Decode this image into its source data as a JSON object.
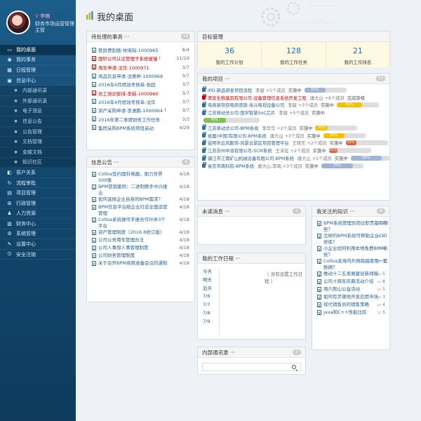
{
  "user": {
    "name": "李楠",
    "role": "财务市场运营管理主管"
  },
  "menu": [
    {
      "label": "我的桌面",
      "icon": "desktop-icon",
      "active": true
    },
    {
      "label": "我的事务",
      "icon": "tasks-icon"
    },
    {
      "label": "日程管理",
      "icon": "calendar-icon"
    },
    {
      "label": "信息中心",
      "icon": "info-icon"
    },
    {
      "label": "内部通讯录",
      "icon": "dot-icon",
      "sub": true
    },
    {
      "label": "外部通讯录",
      "icon": "dot-icon",
      "sub": true
    },
    {
      "label": "电子消息",
      "icon": "dot-icon",
      "sub": true
    },
    {
      "label": "信息公告",
      "icon": "dot-icon",
      "sub": true
    },
    {
      "label": "公告管理",
      "icon": "dot-icon",
      "sub": true
    },
    {
      "label": "文档管理",
      "icon": "dot-icon",
      "sub": true
    },
    {
      "label": "金蝶文档",
      "icon": "dot-icon",
      "sub": true
    },
    {
      "label": "知识社区",
      "icon": "dot-icon",
      "sub": true
    },
    {
      "label": "客户关系",
      "icon": "crm-icon"
    },
    {
      "label": "流程审批",
      "icon": "workflow-icon"
    },
    {
      "label": "项目管理",
      "icon": "project-icon"
    },
    {
      "label": "行政管理",
      "icon": "admin-icon"
    },
    {
      "label": "人力资源",
      "icon": "hr-icon"
    },
    {
      "label": "财务中心",
      "icon": "finance-icon"
    },
    {
      "label": "系统管理",
      "icon": "system-icon"
    },
    {
      "label": "设置中心",
      "icon": "settings-icon"
    },
    {
      "label": "安全注销",
      "icon": "logout-icon"
    }
  ],
  "page_title": "我的桌面",
  "todo": {
    "title": "待处理的事务 ···",
    "count": "18",
    "items": [
      {
        "text": "管龄费刮画-休境瑶-1000965",
        "date": "8/4",
        "red": false
      },
      {
        "text": "国轩公司认证管理子系统缓慢",
        "date": "11/19",
        "red": true,
        "excl": true
      },
      {
        "text": "周年申请-沈华-1000971",
        "date": "3/7",
        "red": true
      },
      {
        "text": "商品信息申请-沈寒婷-1000968",
        "date": "3/7",
        "red": false
      },
      {
        "text": "2016年4月绩效考核单-张超",
        "date": "3/7",
        "red": false
      },
      {
        "text": "员工培训安排-李娟-1000960",
        "date": "3/7",
        "red": true
      },
      {
        "text": "2016年4月绩效考核单-沈华",
        "date": "3/7",
        "red": false
      },
      {
        "text": "资产采购申请-李潇鹏-1000964",
        "date": "3/7",
        "red": false,
        "excl": true
      },
      {
        "text": "2016年第二季度财务工作任务",
        "date": "3/3",
        "red": false
      },
      {
        "text": "集团采购BPM系统项目启动",
        "date": "4/29",
        "red": false
      }
    ]
  },
  "notice": {
    "title": "信息公告 ···",
    "count": "8",
    "items": [
      {
        "text": "Colloa签约国科电器，助力世界500强",
        "date": "4/18"
      },
      {
        "text": "BPM营销案例：二进制携手中兴维业",
        "date": "4/18"
      },
      {
        "text": "如何选择企业自身的BPM需求？",
        "date": "4/18"
      },
      {
        "text": "BPM信息平台助企业打造全面运营管理",
        "date": "4/18"
      },
      {
        "text": "Colloa系统操作手册合作伙伴3个平台",
        "date": "4/18"
      },
      {
        "text": "资产管理制度（2016.8修订版）",
        "date": "4/18"
      },
      {
        "text": "公司公务用车管理办法",
        "date": "4/18"
      },
      {
        "text": "公司人事部人事管理制度",
        "date": "4/18"
      },
      {
        "text": "公司财务管理制度",
        "date": "4/18"
      },
      {
        "text": "关于召开BPM商用准备会议的通知",
        "date": "4/18"
      }
    ]
  },
  "goals": {
    "title": "目标管理",
    "cells": [
      {
        "num": "36",
        "label": "我的工作计划"
      },
      {
        "num": "128",
        "label": "我的工作任务"
      },
      {
        "num": "21",
        "label": "我的工作排名"
      }
    ]
  },
  "projects": {
    "title": "我的项目 ···",
    "count": "13",
    "items": [
      {
        "name": "IPD-新品研发项目流程",
        "meta": "李骏 +5个成员",
        "status": "实施中",
        "pct": 50,
        "color": "#9fb3d6",
        "red": false
      },
      {
        "name": "南安生物基因有限公司-设备管理信息系统开发工程",
        "meta": "唐大山 +6个成员",
        "status": "完成审核",
        "pct": null,
        "red": true
      },
      {
        "name": "电商新项目电商营销-永兴电视设备公司",
        "meta": "李骏 +5个成员",
        "status": "实施中",
        "pct": 60,
        "color": "#f2c200",
        "red": false
      },
      {
        "name": "江苏移动总公司-国学智慧SoC芯片",
        "meta": "李骏 +5个成员",
        "status": "实施中",
        "pct": 40,
        "color": "#7cc456",
        "red": false
      },
      {
        "name": "江苏移动总公司-BPM系统",
        "meta": "李华华 +2个成员",
        "status": "实施中",
        "pct": 30,
        "color": "#f2c200",
        "red": false
      },
      {
        "name": "省属(中国)有限公司-BPM系统",
        "meta": "唐大山 +3个成员",
        "status": "实施中",
        "pct": 50,
        "color": "#f2c200",
        "red": false
      },
      {
        "name": "昆明市云风服饰-风景云景区项目管理平台",
        "meta": "王晓东 +2个成员",
        "status": "实施中",
        "pct": 25,
        "color": "#e0603a",
        "red": false
      },
      {
        "name": "江苏苏州中咨有限公司-SCM系统",
        "meta": "王泽宏 +2个成员",
        "status": "实施中",
        "pct": 20,
        "color": "#e0603a",
        "red": false
      },
      {
        "name": "镇江市江南矿山机械设备有限公司-BPM系统",
        "meta": "唐大山 +1个成员",
        "status": "实施中",
        "pct": 80,
        "color": "#9fb3d6",
        "red": false
      },
      {
        "name": "省农市南科院-BPM系统",
        "meta": "唐大山,李晓,+3个成员",
        "status": "实施中",
        "pct": 75,
        "color": "#9fb3d6",
        "red": false
      }
    ]
  },
  "messages": {
    "title": "未读消息 ···",
    "count": "0"
  },
  "schedule": {
    "title": "我的工作日程 ···",
    "hint": "（ 没有设置工作日程 ）",
    "days": [
      "今天",
      "明天",
      "后天",
      "7/6",
      "7/7",
      "7/8",
      "7/9"
    ]
  },
  "knowledge": {
    "title": "我关注的知识 ···",
    "count": "8",
    "items": [
      {
        "text": "BPM系统管理员岗位职责都有哪些？",
        "num": "6"
      },
      {
        "text": "怎样的BPM系统可帮助企业CIO修炼？",
        "num": "7"
      },
      {
        "text": "小企业如何利用本地免费BPM系统？",
        "num": "4"
      },
      {
        "text": "Colloa支持内外网跨越使用一套数据？",
        "num": "1"
      },
      {
        "text": "推动十二五发展建设新闻稿",
        "num": "5"
      },
      {
        "text": "公司十周年庆典活动介绍",
        "num": "8"
      },
      {
        "text": "周六爬山公益活动",
        "num": "5"
      },
      {
        "text": "如何有步骤地开发应用市场",
        "num": "3"
      },
      {
        "text": "现代销售员的销售策略",
        "num": "4"
      },
      {
        "text": "java和C++性能比较",
        "num": "5"
      }
    ]
  },
  "contacts": {
    "title": "内部通讯录 ···",
    "count": "0"
  }
}
